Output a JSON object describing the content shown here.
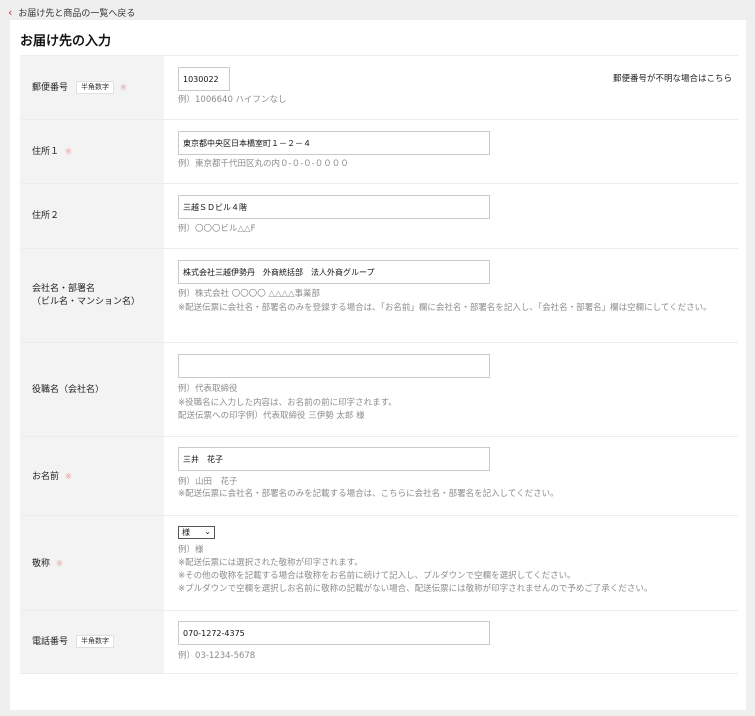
{
  "nav": {
    "back_label": "お届け先と商品の一覧へ戻る"
  },
  "page": {
    "title": "お届け先の入力"
  },
  "form": {
    "postal": {
      "label": "郵便番号",
      "tag": "半角数字",
      "required_mark": "※",
      "value": "1030022",
      "example": "例）1006640 ハイフンなし",
      "help_link": "郵便番号が不明な場合はこちら"
    },
    "address1": {
      "label": "住所１",
      "required_mark": "※",
      "value": "東京都中央区日本橋室町１－２－４",
      "example": "例）東京都千代田区丸の内０-０-０-００００"
    },
    "address2": {
      "label": "住所２",
      "value": "三越ＳＤビル４階",
      "example": "例）〇〇〇ビル△△F"
    },
    "company": {
      "label_line1": "会社名・部署名",
      "label_line2": "（ビル名・マンション名）",
      "value": "株式会社三越伊勢丹　外商統括部　法人外商グループ",
      "example": "例）株式会社 〇〇〇〇 △△△△事業部",
      "note": "※配送伝票に会社名・部署名のみを登録する場合は、「お名前」欄に会社名・部署名を記入し、「会社名・部署名」欄は空欄にしてください。"
    },
    "title": {
      "label": "役職名（会社名）",
      "value": "",
      "example": "例）代表取締役",
      "note1": "※役職名に入力した内容は、お名前の前に印字されます。",
      "note2": "配送伝票への印字例）代表取締役 三伊勢 太郎 様"
    },
    "name": {
      "label": "お名前",
      "required_mark": "※",
      "value": "三井　花子",
      "example": "例）山田　花子",
      "note": "※配送伝票に会社名・部署名のみを記載する場合は、こちらに会社名・部署名を記入してください。"
    },
    "honorific": {
      "label": "敬称",
      "required_mark": "※",
      "selected": "様",
      "caret_icon": "chevron-down-icon",
      "example": "例）様",
      "note1": "※配送伝票には選択された敬称が印字されます。",
      "note2": "※その他の敬称を記載する場合は敬称をお名前に続けて記入し、プルダウンで空欄を選択してください。",
      "note3": "※プルダウンで空欄を選択しお名前に敬称の記載がない場合、配送伝票には敬称が印字されませんので予めご了承ください。"
    },
    "phone": {
      "label": "電話番号",
      "tag": "半角数字",
      "value": "070-1272-4375",
      "example": "例）03-1234-5678"
    }
  },
  "colors": {
    "accent": "#c0392b",
    "required": "#e7a0a0",
    "hint": "#8c8c8c",
    "label_bg": "#f3f3f3"
  }
}
